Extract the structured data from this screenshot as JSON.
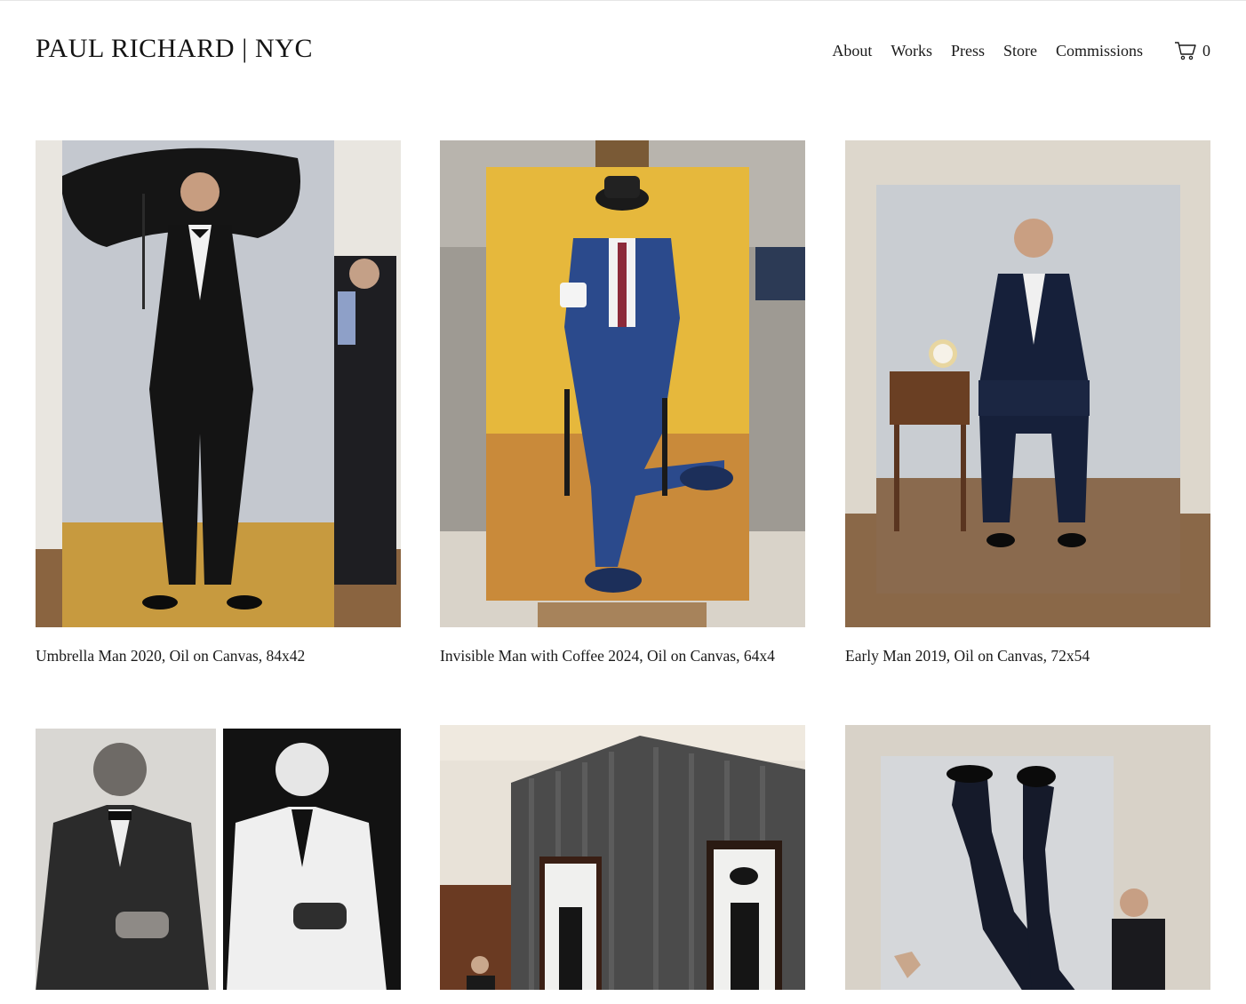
{
  "site": {
    "title": "PAUL RICHARD | NYC"
  },
  "nav": {
    "items": [
      "About",
      "Works",
      "Press",
      "Store",
      "Commissions"
    ],
    "cart_icon": "cart-icon",
    "cart_count": "0"
  },
  "works": [
    {
      "caption": "Umbrella Man 2020, Oil on Canvas, 84x42"
    },
    {
      "caption": "Invisible Man with Coffee 2024, Oil on Canvas, 64x4"
    },
    {
      "caption": "Early Man 2019, Oil on Canvas, 72x54"
    },
    {
      "caption": ""
    },
    {
      "caption": ""
    },
    {
      "caption": ""
    }
  ]
}
